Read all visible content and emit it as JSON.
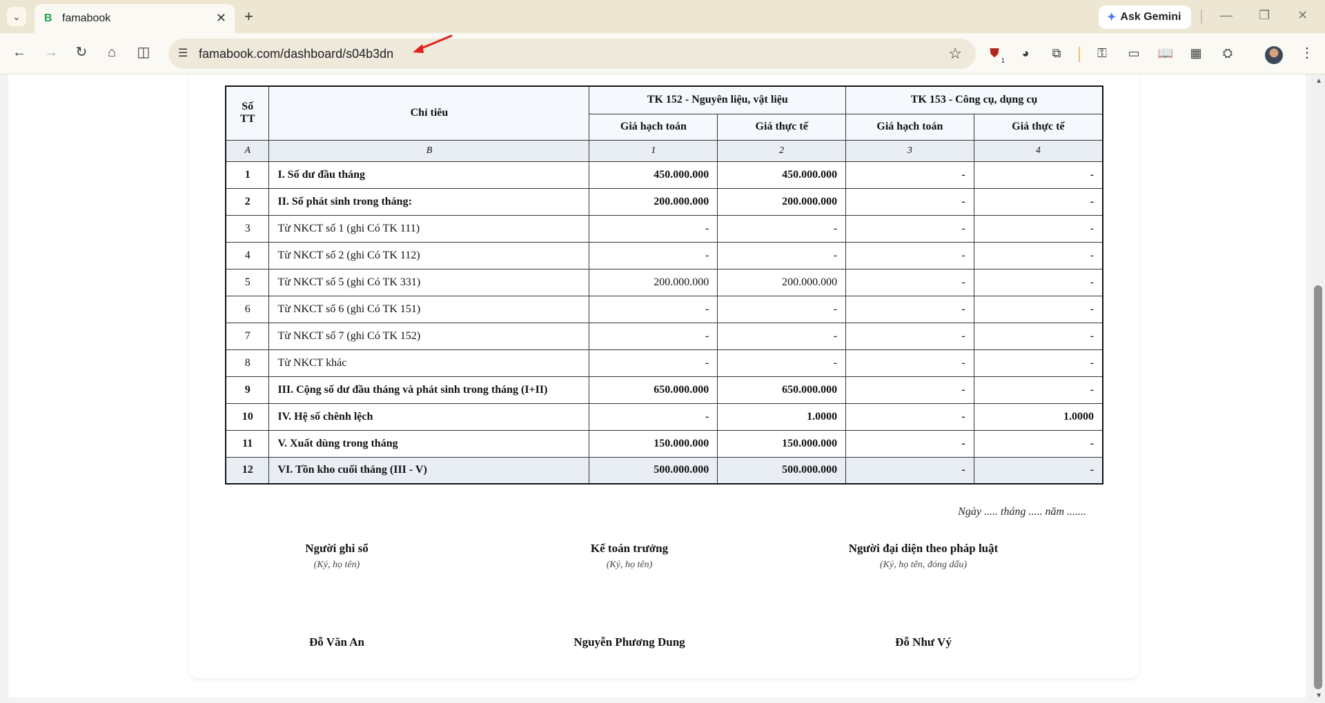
{
  "browser": {
    "tab_title": "famabook",
    "tab_favicon": "B",
    "url": "famabook.com/dashboard/s04b3dn",
    "ask_gemini": "Ask Gemini",
    "extension_badge": "1"
  },
  "table": {
    "header": {
      "stt": "Số TT",
      "chi_tieu": "Chỉ tiêu",
      "tk152": "TK 152 - Nguyên liệu, vật liệu",
      "tk153": "TK 153 - Công cụ, dụng cụ",
      "gia_hach_toan": "Giá hạch toán",
      "gia_thuc_te": "Giá thực tế"
    },
    "index_row": [
      "A",
      "B",
      "1",
      "2",
      "3",
      "4"
    ],
    "rows": [
      {
        "stt": "1",
        "label": "I. Số dư đầu tháng",
        "c1": "450.000.000",
        "c2": "450.000.000",
        "c3": "-",
        "c4": "-"
      },
      {
        "stt": "2",
        "label": "II. Số phát sinh trong tháng:",
        "c1": "200.000.000",
        "c2": "200.000.000",
        "c3": "-",
        "c4": "-"
      },
      {
        "stt": "3",
        "label": "Từ NKCT số 1 (ghi Có TK 111)",
        "c1": "-",
        "c2": "-",
        "c3": "-",
        "c4": "-"
      },
      {
        "stt": "4",
        "label": "Từ NKCT số 2 (ghi Có TK 112)",
        "c1": "-",
        "c2": "-",
        "c3": "-",
        "c4": "-"
      },
      {
        "stt": "5",
        "label": "Từ NKCT số 5 (ghi Có TK 331)",
        "c1": "200.000.000",
        "c2": "200.000.000",
        "c3": "-",
        "c4": "-"
      },
      {
        "stt": "6",
        "label": "Từ NKCT số 6 (ghi Có TK 151)",
        "c1": "-",
        "c2": "-",
        "c3": "-",
        "c4": "-"
      },
      {
        "stt": "7",
        "label": "Từ NKCT số 7 (ghi Có TK 152)",
        "c1": "-",
        "c2": "-",
        "c3": "-",
        "c4": "-"
      },
      {
        "stt": "8",
        "label": "Từ NKCT khác",
        "c1": "-",
        "c2": "-",
        "c3": "-",
        "c4": "-"
      },
      {
        "stt": "9",
        "label": "III. Cộng số dư đầu tháng và phát sinh trong tháng (I+II)",
        "c1": "650.000.000",
        "c2": "650.000.000",
        "c3": "-",
        "c4": "-"
      },
      {
        "stt": "10",
        "label": "IV. Hệ số chênh lệch",
        "c1": "-",
        "c2": "1.0000",
        "c3": "-",
        "c4": "1.0000"
      },
      {
        "stt": "11",
        "label": "V. Xuất dùng trong tháng",
        "c1": "150.000.000",
        "c2": "150.000.000",
        "c3": "-",
        "c4": "-"
      },
      {
        "stt": "12",
        "label": "VI. Tồn kho cuối tháng (III - V)",
        "c1": "500.000.000",
        "c2": "500.000.000",
        "c3": "-",
        "c4": "-"
      }
    ]
  },
  "signatures": {
    "date_line": "Ngày ..... tháng ..... năm .......",
    "blocks": [
      {
        "role": "Người ghi sổ",
        "note": "(Ký, họ tên)",
        "name": "Đỗ Văn An"
      },
      {
        "role": "Kế toán trưởng",
        "note": "(Ký, họ tên)",
        "name": "Nguyễn Phương Dung"
      },
      {
        "role": "Người đại diện theo pháp luật",
        "note": "(Ký, họ tên, đóng dấu)",
        "name": "Đỗ Như Vý"
      }
    ]
  }
}
